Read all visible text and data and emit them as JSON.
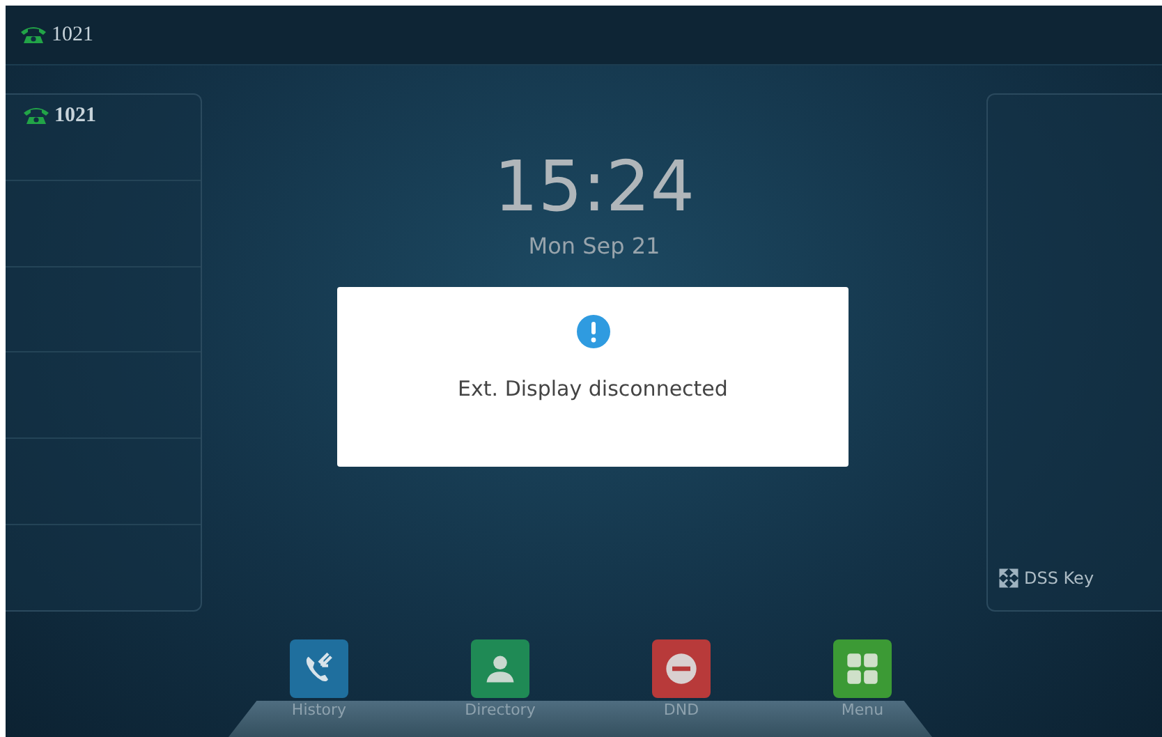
{
  "status_bar": {
    "account": "1021"
  },
  "line_keys": [
    {
      "label": "1021",
      "kind": "account"
    },
    {
      "kind": "empty"
    },
    {
      "kind": "empty"
    },
    {
      "kind": "empty"
    },
    {
      "kind": "empty"
    },
    {
      "kind": "empty"
    }
  ],
  "clock": {
    "time": "15:24",
    "date": "Mon Sep 21"
  },
  "dss_panel": {
    "label": "DSS Key"
  },
  "dialog": {
    "message": "Ext. Display disconnected"
  },
  "dock": [
    {
      "label": "History",
      "kind": "history"
    },
    {
      "label": "Directory",
      "kind": "directory"
    },
    {
      "label": "DND",
      "kind": "dnd"
    },
    {
      "label": "Menu",
      "kind": "menu"
    }
  ]
}
